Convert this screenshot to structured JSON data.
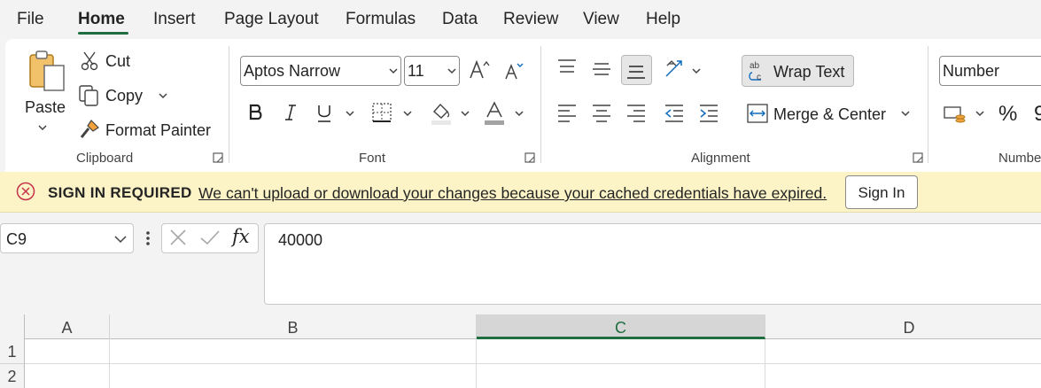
{
  "menu": {
    "tabs": [
      "File",
      "Home",
      "Insert",
      "Page Layout",
      "Formulas",
      "Data",
      "Review",
      "View",
      "Help"
    ],
    "active": "Home"
  },
  "clipboard": {
    "paste_label": "Paste",
    "cut_label": "Cut",
    "copy_label": "Copy",
    "format_painter_label": "Format Painter",
    "group_label": "Clipboard"
  },
  "font": {
    "family": "Aptos Narrow",
    "size": "11",
    "group_label": "Font"
  },
  "alignment": {
    "wrap_text_label": "Wrap Text",
    "merge_center_label": "Merge & Center",
    "group_label": "Alignment"
  },
  "number": {
    "format": "Number",
    "group_label": "Numbe"
  },
  "notification": {
    "title": "SIGN IN REQUIRED",
    "message": "We can't upload or download your changes because your cached credentials have expired.",
    "button_label": "Sign In"
  },
  "formula_bar": {
    "name_box": "C9",
    "fx_label": "fx",
    "formula": "40000"
  },
  "grid": {
    "columns": [
      "A",
      "B",
      "C",
      "D"
    ],
    "selected_column": "C",
    "rows": [
      "1",
      "2"
    ]
  },
  "colors": {
    "accent": "#1e6e3f",
    "notice_bg": "#fcf4c7",
    "error_icon": "#c4314b"
  }
}
